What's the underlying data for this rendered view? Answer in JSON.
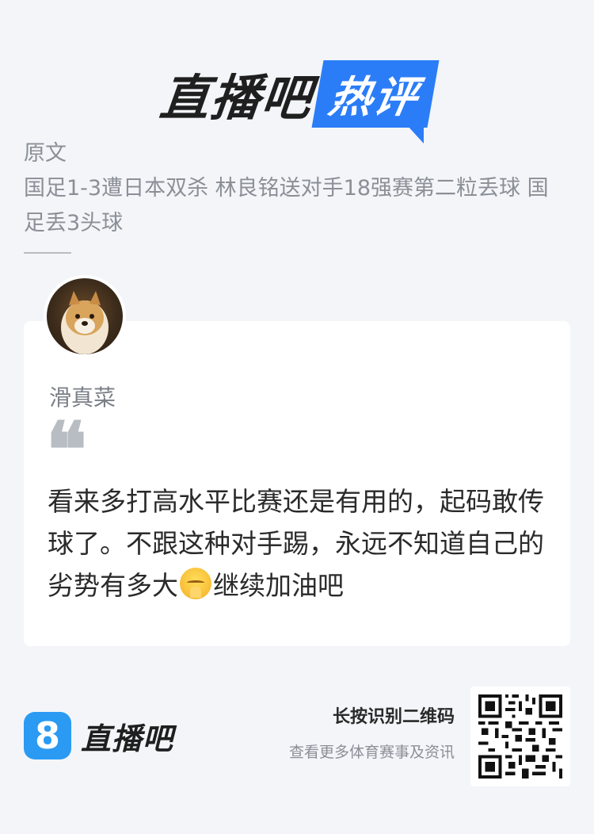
{
  "header": {
    "logo_main": "直播吧",
    "logo_hot": "热评"
  },
  "origin": {
    "label": "原文",
    "title": "国足1-3遭日本双杀 林良铭送对手18强赛第二粒丢球 国足丢3头球"
  },
  "comment": {
    "username": "滑真菜",
    "quote_mark": "❝",
    "text_before_emoji": "看来多打高水平比赛还是有用的，起码敢传球了。不跟这种对手踢，永远不知道自己的劣势有多大",
    "emoji_icon": "pensive-face-icon",
    "text_after_emoji": "继续加油吧"
  },
  "footer": {
    "brand_badge": "8",
    "brand_name": "直播吧",
    "qr_title": "长按识别二维码",
    "qr_subtitle": "查看更多体育赛事及资讯"
  },
  "colors": {
    "accent_blue": "#2b7df7",
    "background": "#f3f5f9"
  }
}
